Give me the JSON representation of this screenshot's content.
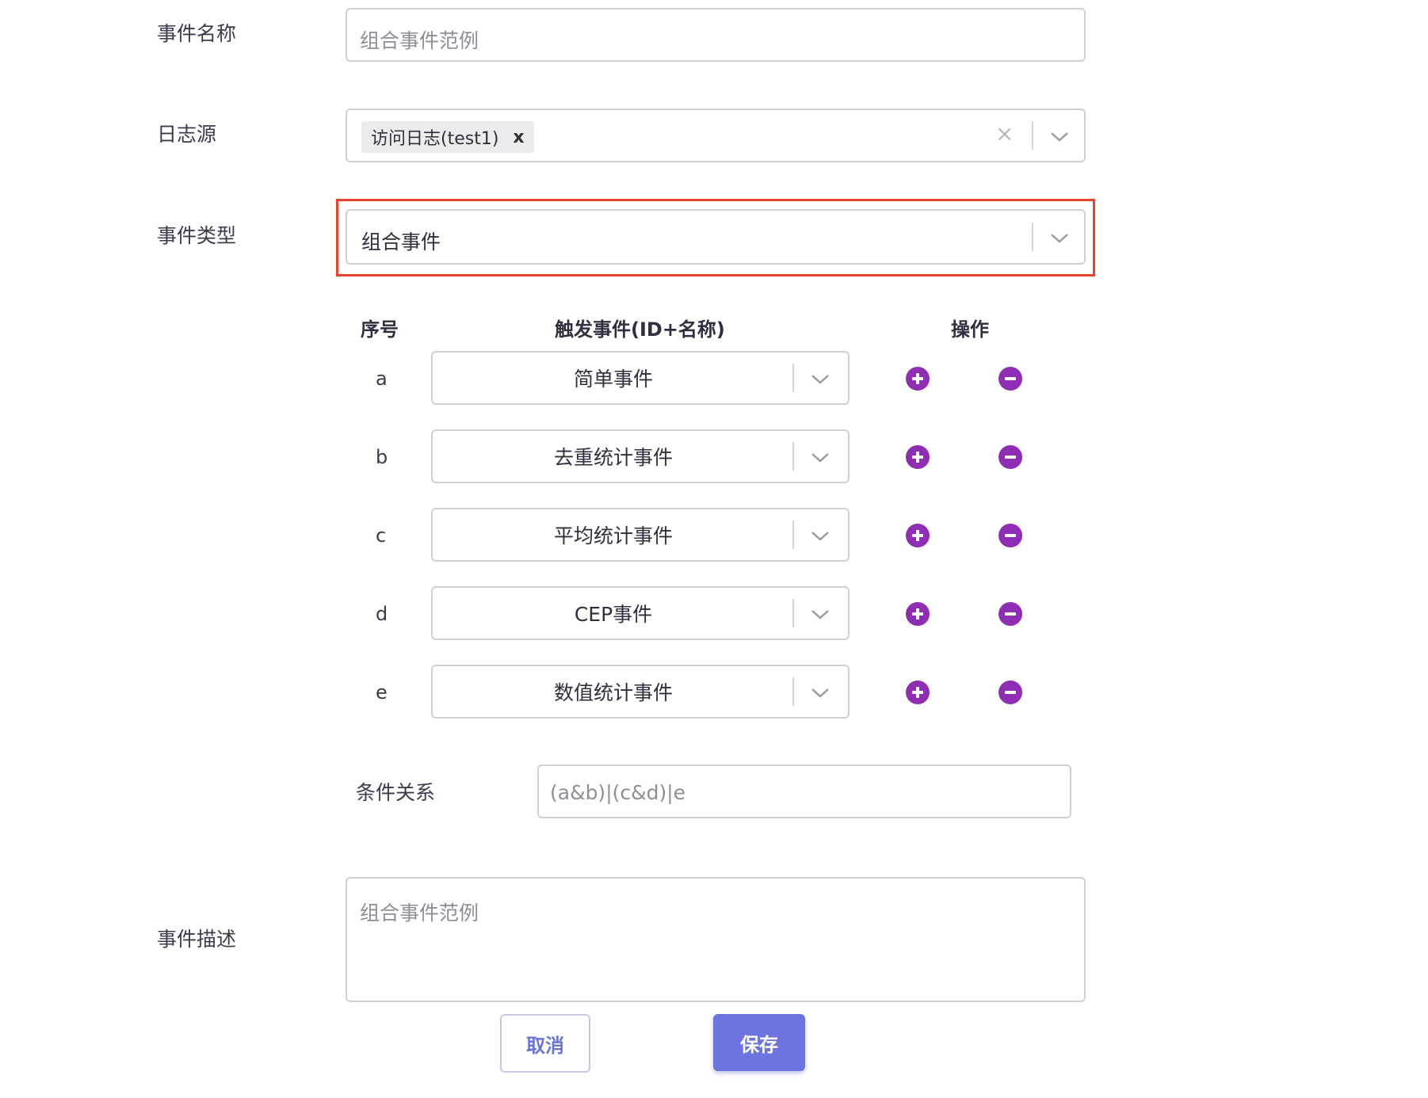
{
  "form": {
    "event_name": {
      "label": "事件名称",
      "placeholder": "组合事件范例"
    },
    "log_source": {
      "label": "日志源",
      "tag": "访问日志(test1)",
      "tag_remove_icon": "x",
      "clear_icon": "×"
    },
    "event_type": {
      "label": "事件类型",
      "value": "组合事件",
      "highlight_color": "#e8452c"
    },
    "trigger_table": {
      "headers": {
        "seq": "序号",
        "event": "触发事件(ID+名称)",
        "action": "操作"
      },
      "rows": [
        {
          "seq": "a",
          "event": "简单事件"
        },
        {
          "seq": "b",
          "event": "去重统计事件"
        },
        {
          "seq": "c",
          "event": "平均统计事件"
        },
        {
          "seq": "d",
          "event": "CEP事件"
        },
        {
          "seq": "e",
          "event": "数值统计事件"
        }
      ],
      "action_color": "#8f2db4"
    },
    "condition": {
      "label": "条件关系",
      "placeholder": "(a&b)|(c&d)|e"
    },
    "description": {
      "label": "事件描述",
      "placeholder": "组合事件范例"
    }
  },
  "buttons": {
    "cancel": "取消",
    "save": "保存",
    "primary_color": "#6b74df"
  }
}
